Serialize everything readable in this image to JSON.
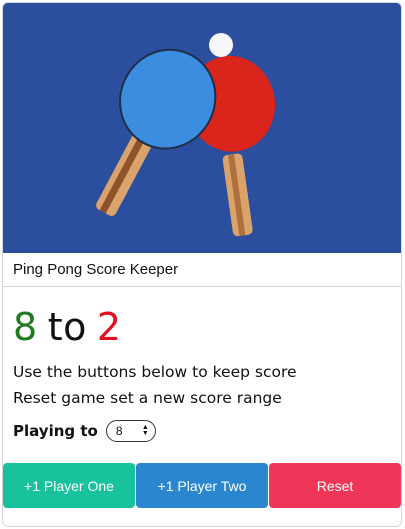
{
  "header": {
    "title": "Ping Pong Score Keeper"
  },
  "score": {
    "player_one": "8",
    "separator": "to",
    "player_two": "2"
  },
  "instructions": {
    "line1": "Use the buttons below to keep score",
    "line2": "Reset game set a new score range"
  },
  "playing_to": {
    "label": "Playing to",
    "selected_value": "8"
  },
  "buttons": {
    "player_one": "+1 Player One",
    "player_two": "+1 Player Two",
    "reset": "Reset"
  },
  "colors": {
    "player_one_score": "#1f7a21",
    "player_two_score": "#e3101f",
    "button_one": "#18c29c",
    "button_two": "#2a86cf",
    "button_reset": "#ee3758",
    "hero_background": "#2b4e9f"
  }
}
